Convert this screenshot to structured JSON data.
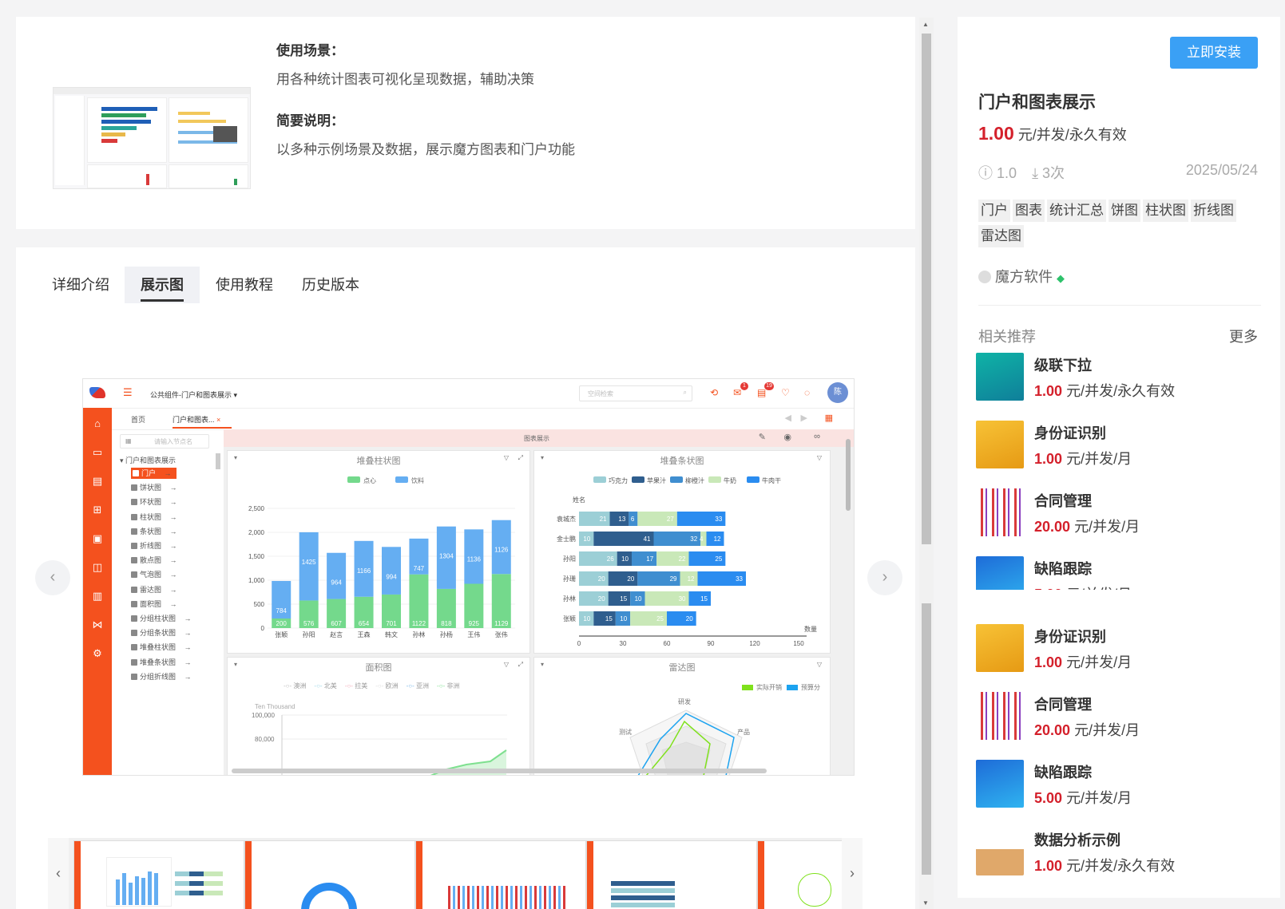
{
  "detail": {
    "scene_label": "使用场景：",
    "scene_text": "用各种统计图表可视化呈现数据，辅助决策",
    "brief_label": "简要说明：",
    "brief_text": "以多种示例场景及数据，展示魔方图表和门户功能"
  },
  "tabs": [
    "详细介绍",
    "展示图",
    "使用教程",
    "历史版本"
  ],
  "preview": {
    "breadcrumb": "公共组件-门户和图表展示",
    "search_placeholder": "空间检索",
    "avatar": "陈",
    "tab_home": "首页",
    "tab_active": "门户和图表...",
    "page_title": "图表展示",
    "tree_search": "请输入节点名",
    "tree_root": "门户和图表展示",
    "tree_items": [
      "门户",
      "饼状图",
      "环状图",
      "柱状图",
      "条状图",
      "折线图",
      "散点图",
      "气泡图",
      "雷达图",
      "面积图",
      "分组柱状图",
      "分组条状图",
      "堆叠柱状图",
      "堆叠条状图",
      "分组折线图"
    ],
    "badges": [
      "1",
      "19"
    ]
  },
  "chart_data": [
    {
      "type": "bar",
      "title": "堆叠柱状图",
      "stacked": true,
      "categories": [
        "张颖",
        "孙阳",
        "赵言",
        "王森",
        "韩文",
        "孙林",
        "孙杨",
        "王伟",
        "张伟"
      ],
      "series": [
        {
          "name": "点心",
          "color": "#74d98c",
          "values": [
            200,
            576,
            607,
            654,
            701,
            1122,
            818,
            925,
            1129
          ]
        },
        {
          "name": "饮料",
          "color": "#65aef2",
          "values": [
            784,
            1425,
            964,
            1166,
            994,
            747,
            1304,
            1136,
            1126
          ]
        }
      ],
      "ylim": [
        0,
        2500
      ],
      "yticks": [
        "0",
        "500",
        "1,000",
        "1,500",
        "2,000",
        "2,500"
      ]
    },
    {
      "type": "bar",
      "title": "堆叠条状图",
      "stacked": true,
      "horizontal": true,
      "categories": [
        "张颖",
        "孙林",
        "孙珊",
        "孙阳",
        "金士鹏",
        "袁城杰"
      ],
      "ylabel": "姓名",
      "xlabel": "数量",
      "series": [
        {
          "name": "巧克力",
          "color": "#9ccfd6",
          "values": [
            10,
            20,
            20,
            26,
            10,
            21
          ]
        },
        {
          "name": "苹果汁",
          "color": "#2f5e8e",
          "values": [
            15,
            15,
            20,
            10,
            41,
            13
          ]
        },
        {
          "name": "柳橙汁",
          "color": "#3f8ed0",
          "values": [
            10,
            10,
            29,
            17,
            32,
            6
          ]
        },
        {
          "name": "牛奶",
          "color": "#c9e8b8",
          "values": [
            25,
            30,
            12,
            22,
            4,
            27
          ]
        },
        {
          "name": "牛肉干",
          "color": "#2a8cf0",
          "values": [
            20,
            15,
            33,
            25,
            12,
            33
          ]
        }
      ],
      "xlim": [
        0,
        150
      ],
      "xticks": [
        "0",
        "30",
        "60",
        "90",
        "120",
        "150"
      ]
    },
    {
      "type": "area",
      "title": "面积图",
      "legend": [
        "澳洲",
        "北美",
        "拉美",
        "欧洲",
        "亚洲",
        "非洲"
      ],
      "ylabel": "Ten Thousand",
      "yticks": [
        "100,000",
        "80,000"
      ]
    },
    {
      "type": "radar",
      "title": "雷达图",
      "legend": [
        "实际开销",
        "预算分"
      ],
      "axes": [
        "研发",
        "产品",
        "测试"
      ]
    }
  ],
  "product": {
    "install": "立即安装",
    "name": "门户和图表展示",
    "price": "1.00",
    "price_unit": "元/并发/永久有效",
    "version": "1.0",
    "downloads": "3次",
    "date": "2025/05/24",
    "tags": [
      "门户",
      "图表",
      "统计汇总",
      "饼图",
      "柱状图",
      "折线图",
      "雷达图"
    ],
    "vendor": "魔方软件"
  },
  "related": {
    "title": "相关推荐",
    "more": "更多",
    "items": [
      {
        "name": "级联下拉",
        "price": "1.00",
        "unit": "元/并发/永久有效"
      },
      {
        "name": "身份证识别",
        "price": "1.00",
        "unit": "元/并发/月"
      },
      {
        "name": "合同管理",
        "price": "20.00",
        "unit": "元/并发/月"
      },
      {
        "name": "缺陷跟踪",
        "price": "5.00",
        "unit": "元/并发/月"
      },
      {
        "name": "身份证识别",
        "price": "1.00",
        "unit": "元/并发/月"
      },
      {
        "name": "合同管理",
        "price": "20.00",
        "unit": "元/并发/月"
      },
      {
        "name": "缺陷跟踪",
        "price": "5.00",
        "unit": "元/并发/月"
      },
      {
        "name": "数据分析示例",
        "price": "1.00",
        "unit": "元/并发/永久有效"
      }
    ]
  },
  "colors": {
    "accent": "#3aa0f5",
    "price": "#d4202b",
    "brand": "#f4511e"
  }
}
